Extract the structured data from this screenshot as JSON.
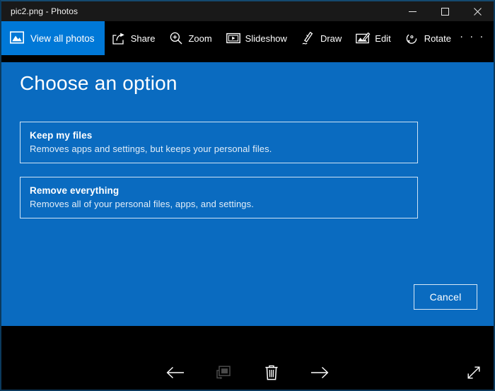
{
  "window": {
    "title": "pic2.png - Photos",
    "controls": [
      {
        "name": "minimize",
        "icon": "minimize-icon",
        "label": "—"
      },
      {
        "name": "maximize",
        "icon": "maximize-icon",
        "label": "□"
      },
      {
        "name": "close",
        "icon": "close-icon",
        "label": "✕"
      }
    ]
  },
  "commandbar": {
    "view_all": {
      "label": "View all photos",
      "icon": "photos-icon",
      "accent": "#0078d7"
    },
    "items": [
      {
        "label": "Share",
        "icon": "share-icon"
      },
      {
        "label": "Zoom",
        "icon": "magnifier-plus-icon"
      },
      {
        "label": "Slideshow",
        "icon": "slideshow-icon"
      },
      {
        "label": "Draw",
        "icon": "pen-icon"
      },
      {
        "label": "Edit",
        "icon": "edit-image-icon"
      },
      {
        "label": "Rotate",
        "icon": "rotate-icon"
      }
    ],
    "more_label": "· · ·"
  },
  "content": {
    "background": "#0a6bc0",
    "heading": "Choose an option",
    "options": [
      {
        "title": "Keep my files",
        "description": "Removes apps and settings, but keeps your personal files."
      },
      {
        "title": "Remove everything",
        "description": "Removes all of your personal files, apps, and settings."
      }
    ],
    "cancel_label": "Cancel"
  },
  "bottombar": {
    "items": [
      {
        "name": "previous",
        "icon": "arrow-left-icon",
        "enabled": true
      },
      {
        "name": "add-to-album",
        "icon": "add-to-album-icon",
        "enabled": false
      },
      {
        "name": "delete",
        "icon": "trash-icon",
        "enabled": true
      },
      {
        "name": "next",
        "icon": "arrow-right-icon",
        "enabled": true
      }
    ],
    "expand": {
      "name": "fullscreen",
      "icon": "expand-diagonal-icon"
    }
  }
}
